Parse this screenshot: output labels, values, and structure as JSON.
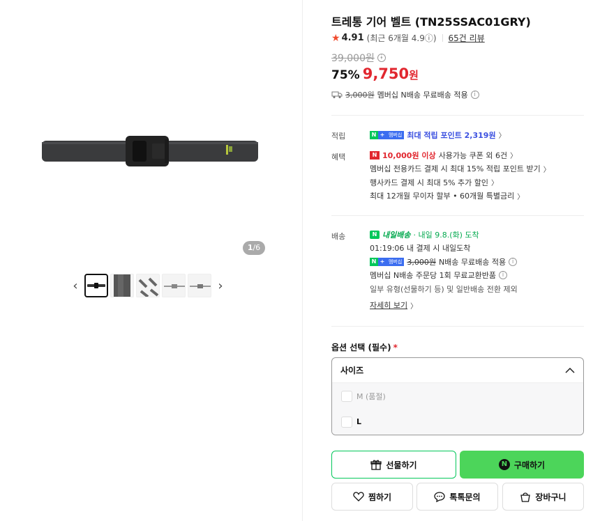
{
  "gallery": {
    "page_current": "1",
    "page_total": "/6",
    "prev_icon": "‹",
    "next_icon": "›",
    "thumbnails": [
      "thumb-1",
      "thumb-2",
      "thumb-3",
      "thumb-4",
      "thumb-5"
    ]
  },
  "product": {
    "title": "트레통 기어 벨트 (TN25SSAC01GRY)",
    "rating": "4.91",
    "recent_rating": "(최근 6개월 4.9ⓘ)",
    "review_count": "65건 리뷰",
    "original_price": "39,000원",
    "discount_rate": "75%",
    "sale_price": "9,750",
    "sale_currency": "원",
    "shipping_fee": "3,000원",
    "shipping_text": "멤버십 N배송 무료배송 적용"
  },
  "points": {
    "label": "적립",
    "badge_n": "N",
    "badge_plus": "+",
    "badge_mem": "멤버십",
    "text": "최대 적립 포인트 2,319원"
  },
  "benefits": {
    "label": "혜택",
    "coupon_badge": "N",
    "coupon_amount": "10,000원 이상",
    "coupon_text": "사용가능 쿠폰 외 6건",
    "line2": "멤버십 전용카드 결제 시 최대 15% 적립 포인트 받기",
    "line3": "행사카드 결제 시 최대 5% 추가 할인",
    "line4": "최대 12개월 무이자 할부 • 60개월 특별금리"
  },
  "delivery": {
    "label": "배송",
    "tomorrow_badge": "N",
    "tomorrow_text": "내일배송",
    "arrival": "· 내일 9.8.(화) 도착",
    "cutoff": "01:19:06  내 결제 시 내일도착",
    "fee": "3,000원",
    "fee_text": "N배송 무료배송 적용",
    "exchange": "멤버십 N배송 주문당 1회 무료교환반품",
    "note": "일부 유형(선물하기 등) 및 일반배송 전환 제외",
    "detail_link": "자세히 보기"
  },
  "options": {
    "title": "옵션 선택 (필수)",
    "required_mark": "*",
    "select_label": "사이즈",
    "items": [
      {
        "label": "M (품절)",
        "soldout": true
      },
      {
        "label": "L",
        "soldout": false
      }
    ]
  },
  "actions": {
    "gift": "선물하기",
    "buy": "구매하기",
    "wish": "찜하기",
    "talk": "톡톡문의",
    "cart": "장바구니"
  },
  "colors": {
    "accent_red": "#e1272f",
    "naver_green": "#03c75a",
    "buy_button": "#4cd55a",
    "point_blue": "#3b50e0"
  }
}
